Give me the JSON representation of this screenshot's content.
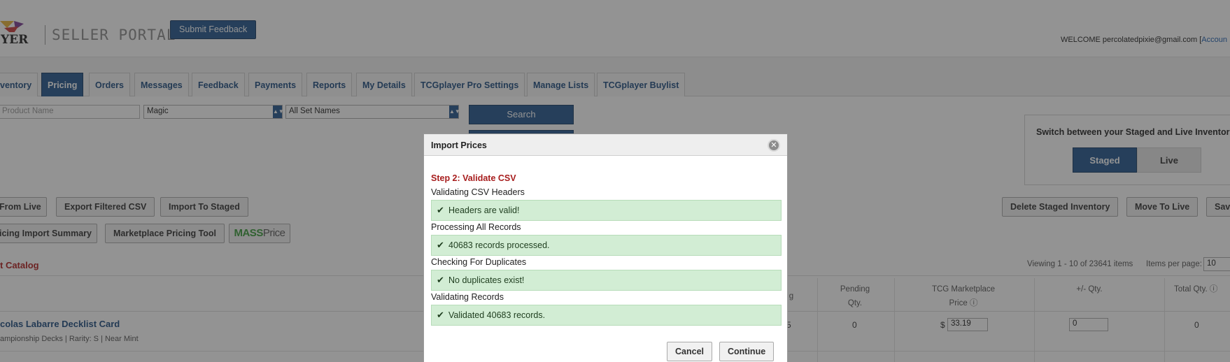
{
  "header": {
    "portal_title": "SELLER PORTAL",
    "feedback_label": "Submit Feedback",
    "welcome_prefix": "WELCOME percolatedpixie@gmail.com [",
    "account_link": "Accoun"
  },
  "nav": {
    "tabs": [
      {
        "label": "ventory"
      },
      {
        "label": "Pricing"
      },
      {
        "label": "Orders"
      },
      {
        "label": "Messages"
      },
      {
        "label": "Feedback"
      },
      {
        "label": "Payments"
      },
      {
        "label": "Reports"
      },
      {
        "label": "My Details"
      },
      {
        "label": "TCGplayer Pro Settings"
      },
      {
        "label": "Manage Lists"
      },
      {
        "label": "TCGplayer Buylist"
      }
    ],
    "active": "Pricing"
  },
  "search": {
    "product_placeholder": "Product Name",
    "game_value": "Magic",
    "set_value": "All Set Names",
    "search_label": "Search"
  },
  "switch_panel": {
    "title": "Switch between your Staged and Live Inventories",
    "staged_label": "Staged",
    "live_label": "Live"
  },
  "actions": {
    "from_live": "From Live",
    "export_filtered_csv": "Export Filtered CSV",
    "import_to_staged": "Import To Staged",
    "pricing_import_summary": "icing Import Summary",
    "marketplace_pricing_tool": "Marketplace Pricing Tool",
    "mass_price_a": "MASS",
    "mass_price_b": "Price",
    "delete_staged": "Delete Staged Inventory",
    "move_to_live": "Move To Live",
    "save": "Sav"
  },
  "catalog": {
    "title": "t Catalog",
    "viewing": "Viewing 1 - 10 of 23641 items",
    "items_per_page_label": "Items per page:",
    "items_per_page_value": "10",
    "columns": {
      "listing_partial": "g",
      "pending_1": "Pending",
      "pending_2": "Qty.",
      "market_1": "TCG Marketplace",
      "market_2": "Price",
      "plusminus": "+/- Qty.",
      "total": "Total Qty."
    },
    "row": {
      "title": "colas Labarre Decklist Card",
      "subtitle": "ampionship Decks | Rarity: S | Near Mint",
      "listing_partial": "5",
      "pending": "0",
      "currency": "$",
      "price": "33.19",
      "plusminus": "0",
      "total": "0"
    }
  },
  "modal": {
    "title": "Import Prices",
    "close_glyph": "✕",
    "step": "Step 2: Validate CSV",
    "sections": [
      {
        "label": "Validating CSV Headers",
        "message": "Headers are valid!"
      },
      {
        "label": "Processing All Records",
        "message": "40683 records processed."
      },
      {
        "label": "Checking For Duplicates",
        "message": "No duplicates exist!"
      },
      {
        "label": "Validating Records",
        "message": "Validated 40683 records."
      }
    ],
    "cancel_label": "Cancel",
    "continue_label": "Continue"
  },
  "colors": {
    "primary_blue": "#24578f",
    "success_bg": "#d2edd4",
    "step_red": "#a71d1d"
  }
}
